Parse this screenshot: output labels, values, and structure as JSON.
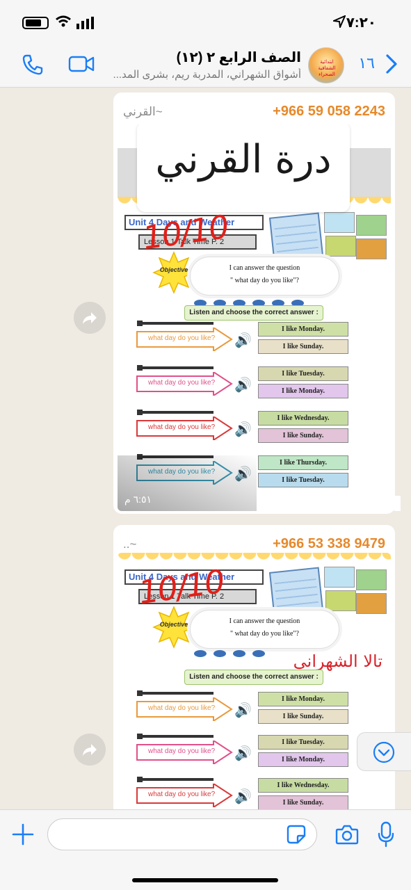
{
  "status_bar": {
    "time": "٧:٢٠"
  },
  "header": {
    "unread_count": "١٦",
    "group_name": "الصف الرابع ٢ (١٢)",
    "participants": "أشواق الشهراني، المدربة ريم، بشرى المد...",
    "avatar_text": "ابتدائية الشفافية الصحراء"
  },
  "messages": [
    {
      "sender_phone": "+966 59 058 2243",
      "sender_name": "~القرني",
      "overlay_name": "درة القرني",
      "timestamp": "٦:٥١ م",
      "grade": "10/10"
    },
    {
      "sender_phone": "+966 53 338 9479",
      "sender_name": "~..",
      "student_name": "تالا الشهراني",
      "grade": "10/10"
    }
  ],
  "worksheet": {
    "unit": "Unit 4  Days and Weather",
    "lesson": "Lesson 1  Talk Time  P. 2",
    "objective": "Objective",
    "objective_line1": "I can answer the question",
    "objective_line2": "\" what day do you like\"?",
    "instruction": "Listen and choose the correct answer :",
    "questions": [
      {
        "q": "what day do you like?",
        "a1": "I like Monday.",
        "a2": "I like Sunday.",
        "color": "#e89a3c",
        "c1": "#cfe0a6",
        "c2": "#e8e0c8"
      },
      {
        "q": "what day do you like?",
        "a1": "I like Tuesday.",
        "a2": "I like Monday.",
        "color": "#e0508a",
        "c1": "#d8d8b0",
        "c2": "#e2c6ec"
      },
      {
        "q": "what day do you like?",
        "a1": "I like Wednesday.",
        "a2": "I like Sunday.",
        "color": "#d9393a",
        "c1": "#c7dca2",
        "c2": "#e3c3d8"
      },
      {
        "q": "what day do you like?",
        "a1": "I like Thursday.",
        "a2": "I like Tuesday.",
        "color": "#3a9bb8",
        "c1": "#bfe6c6",
        "c2": "#b8dcee"
      }
    ]
  },
  "colors": {
    "accent": "#1a7ef6",
    "phone": "#e6892a",
    "grade": "#e0201a"
  }
}
